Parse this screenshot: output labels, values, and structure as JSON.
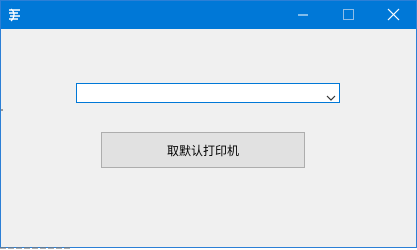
{
  "window": {
    "title": "",
    "caption_buttons": {
      "minimize_icon": "minimize-icon",
      "maximize_icon": "maximize-icon",
      "close_icon": "close-icon"
    },
    "accent_color": "#0078d7"
  },
  "printer_select": {
    "value": "",
    "dropdown_icon": "chevron-down-icon"
  },
  "actions": {
    "default_printer_button": "取默认打印机"
  }
}
